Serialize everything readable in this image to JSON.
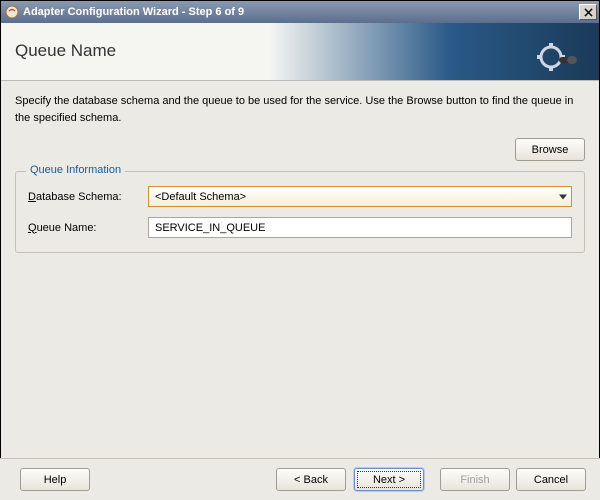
{
  "window": {
    "title": "Adapter Configuration Wizard - Step 6 of 9"
  },
  "banner": {
    "heading": "Queue Name"
  },
  "instructions": "Specify the database schema and the queue to be used for the service. Use the Browse button to find the queue in the specified schema.",
  "browse_label": "Browse",
  "group": {
    "legend": "Queue Information",
    "schema_label_pre": "D",
    "schema_label_rest": "atabase Schema:",
    "schema_value": "<Default Schema>",
    "queue_label_pre": "Q",
    "queue_label_rest": "ueue Name:",
    "queue_value": "SERVICE_IN_QUEUE"
  },
  "footer": {
    "help": "Help",
    "back": "< Back",
    "next": "Next >",
    "finish": "Finish",
    "cancel": "Cancel"
  }
}
